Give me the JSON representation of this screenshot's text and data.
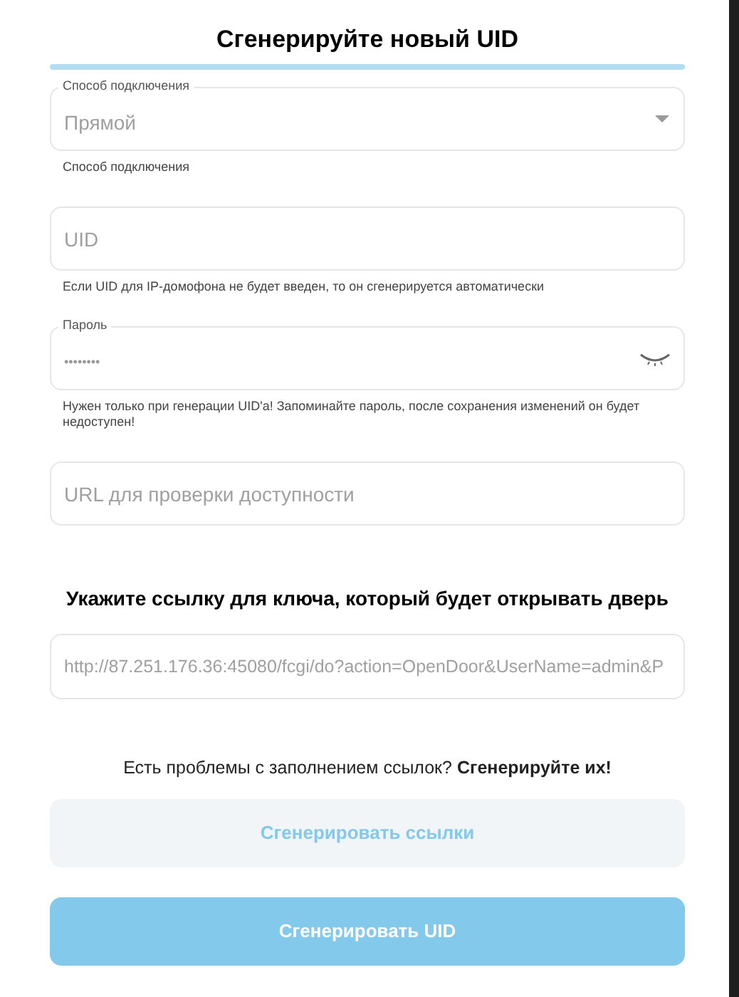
{
  "title": "Сгенерируйте новый UID",
  "fields": [
    {
      "kind": "select",
      "label": "Способ подключения",
      "value": "Прямой",
      "helper": "Способ подключения"
    },
    {
      "kind": "text",
      "placeholder": "UID",
      "helper": "Если UID для IP-домофона не будет введен, то он сгенерируется автоматически"
    },
    {
      "kind": "password",
      "label": "Пароль",
      "value": "••••••••",
      "visible": false,
      "helper": "Нужен только при генерации UID'a! Запоминайте пароль, после сохранения изменений он будет недоступен!"
    },
    {
      "kind": "text",
      "placeholder": "URL для проверки доступности"
    }
  ],
  "key_section": {
    "heading": "Укажите ссылку для ключа, который будет открывать дверь",
    "value": "http://87.251.176.36:45080/fcgi/do?action=OpenDoor&UserName=admin&P"
  },
  "prompt": "Есть проблемы с заполнением ссылок? **Сгенерируйте их!**",
  "buttons": [
    {
      "label": "Сгенерировать ссылки",
      "kind": "secondary"
    },
    {
      "label": "Сгенерировать UID",
      "kind": "primary"
    }
  ]
}
